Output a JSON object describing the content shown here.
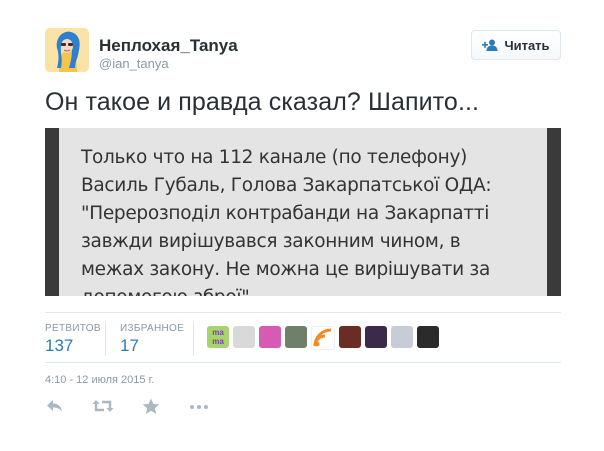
{
  "user": {
    "name": "Неплохая_Tanya",
    "handle": "@ian_tanya"
  },
  "follow_button": {
    "label": "Читать"
  },
  "tweet": {
    "text": "Он такое и правда сказал? Шапито...",
    "media_lines": [
      "Только что на 112 канале (по телефону)",
      "Василь Губаль, Голова Закарпатської ОДА:",
      "\"Перерозподіл контрабанди на Закарпатті",
      "завжди вирішувався  законним чином,  в",
      "межах закону. Не можна це вирішувати за",
      "допомогою зброї\"."
    ],
    "timestamp": "4:10 - 12 июля 2015 г."
  },
  "stats": {
    "retweets_label": "РЕТВИТОВ",
    "retweets_value": "137",
    "favorites_label": "ИЗБРАННОЕ",
    "favorites_value": "17"
  },
  "favoriters": [
    {
      "name": "favoriter-avatar-1",
      "text": "ma ma",
      "color": "#a9d36b"
    },
    {
      "name": "favoriter-avatar-2",
      "text": "",
      "color": "#d9d9d9"
    },
    {
      "name": "favoriter-avatar-3",
      "text": "",
      "color": "#d75bb3"
    },
    {
      "name": "favoriter-avatar-4",
      "text": "",
      "color": "#6e7f6a"
    },
    {
      "name": "favoriter-avatar-5",
      "text": "",
      "color": "#ffffff"
    },
    {
      "name": "favoriter-avatar-6",
      "text": "",
      "color": "#6b2d23"
    },
    {
      "name": "favoriter-avatar-7",
      "text": "",
      "color": "#3b2a4a"
    },
    {
      "name": "favoriter-avatar-8",
      "text": "",
      "color": "#c7ccd6"
    },
    {
      "name": "favoriter-avatar-9",
      "text": "",
      "color": "#2b2b2b"
    }
  ],
  "colors": {
    "link_blue": "#2b7bb9",
    "muted": "#8899a6",
    "text": "#292f33",
    "border": "#e1e8ed"
  },
  "icons": {
    "follow": "add-user-icon",
    "reply": "reply-icon",
    "retweet": "retweet-icon",
    "favorite": "star-icon",
    "more": "more-icon"
  }
}
